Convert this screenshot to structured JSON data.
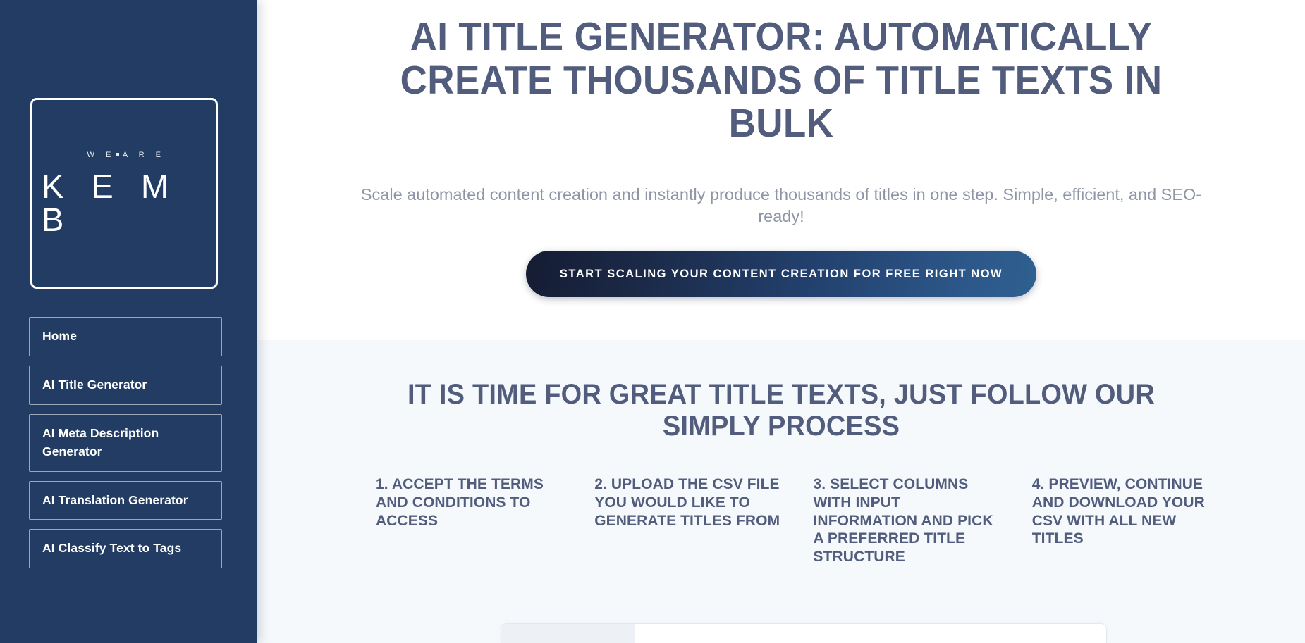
{
  "sidebar": {
    "logo": {
      "tagline_part1": "W E",
      "separator_icon": "square-separator-icon",
      "tagline_part2": "A R E",
      "brand": "K E M B"
    },
    "nav_items": [
      {
        "label": "Home",
        "name": "home"
      },
      {
        "label": "AI Title Generator",
        "name": "ai-title-generator"
      },
      {
        "label": "AI Meta Description Generator",
        "name": "ai-meta-description-generator"
      },
      {
        "label": "AI Translation Generator",
        "name": "ai-translation-generator"
      },
      {
        "label": "AI Classify Text to Tags",
        "name": "ai-classify-text-to-tags"
      }
    ]
  },
  "hero": {
    "title": "AI Title Generator:  Automatically create thousands of title texts in bulk",
    "subtitle": "Scale automated content creation and instantly produce thousands of titles in one step. Simple, efficient, and SEO-ready!",
    "cta_label": "Start scaling your content creation for free right now"
  },
  "process": {
    "title": "It is time for great title texts, just follow our simply process",
    "steps": [
      "1. Accept the terms and conditions to access",
      "2. Upload the CSV file you would like to generate titles from",
      "3. Select columns with input information and pick a preferred title structure",
      "4. Preview, continue and download your CSV with all new titles"
    ]
  },
  "colors": {
    "sidebar_navy": "#233C63",
    "heading_slate": "#525D7D",
    "subtitle_gray": "#8E95A6",
    "section_background": "#F5F9FC",
    "cta_gradient_start": "#151C33",
    "cta_gradient_end": "#2F608F"
  }
}
